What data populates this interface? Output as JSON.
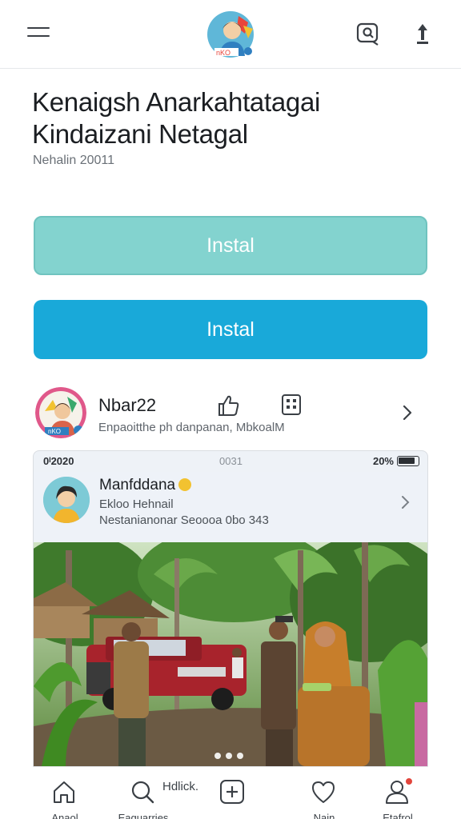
{
  "header": {
    "menu_icon": "hamburger-menu-icon",
    "logo": "app-logo",
    "search_icon": "search-chat-icon",
    "share_icon": "share-upload-icon"
  },
  "app": {
    "title_line1": "Kenaigsh Anarkahtatagai",
    "title_line2": "Kindaizani Netagal",
    "subtitle": "Nehalin 20011"
  },
  "buttons": {
    "install_primary": "Instal",
    "install_secondary": "Instal"
  },
  "profile": {
    "name": "Nbar22",
    "description": "Enpaoitthe ph danpanan, MbkoalM"
  },
  "preview": {
    "status_left": "0ᴵ2020",
    "status_center": "0031",
    "status_right": "20%",
    "account_name": "Manfddana",
    "line1": "Ekloo Hehnail",
    "line2": "Nestanianonar Seoooa 0bo 343"
  },
  "bottom_nav": {
    "items": [
      {
        "label": "Anaol",
        "icon": "home-icon"
      },
      {
        "label": "Eaguarries",
        "icon": "search-icon"
      },
      {
        "label": "",
        "icon": "add-icon"
      },
      {
        "label": "Nain",
        "icon": "heart-icon"
      },
      {
        "label": "Etafrol",
        "icon": "profile-icon"
      }
    ],
    "extra_text": "Hdlick."
  },
  "colors": {
    "install_primary_bg": "#83d3cf",
    "install_secondary_bg": "#19a9d9",
    "notification": "#e2453c"
  }
}
